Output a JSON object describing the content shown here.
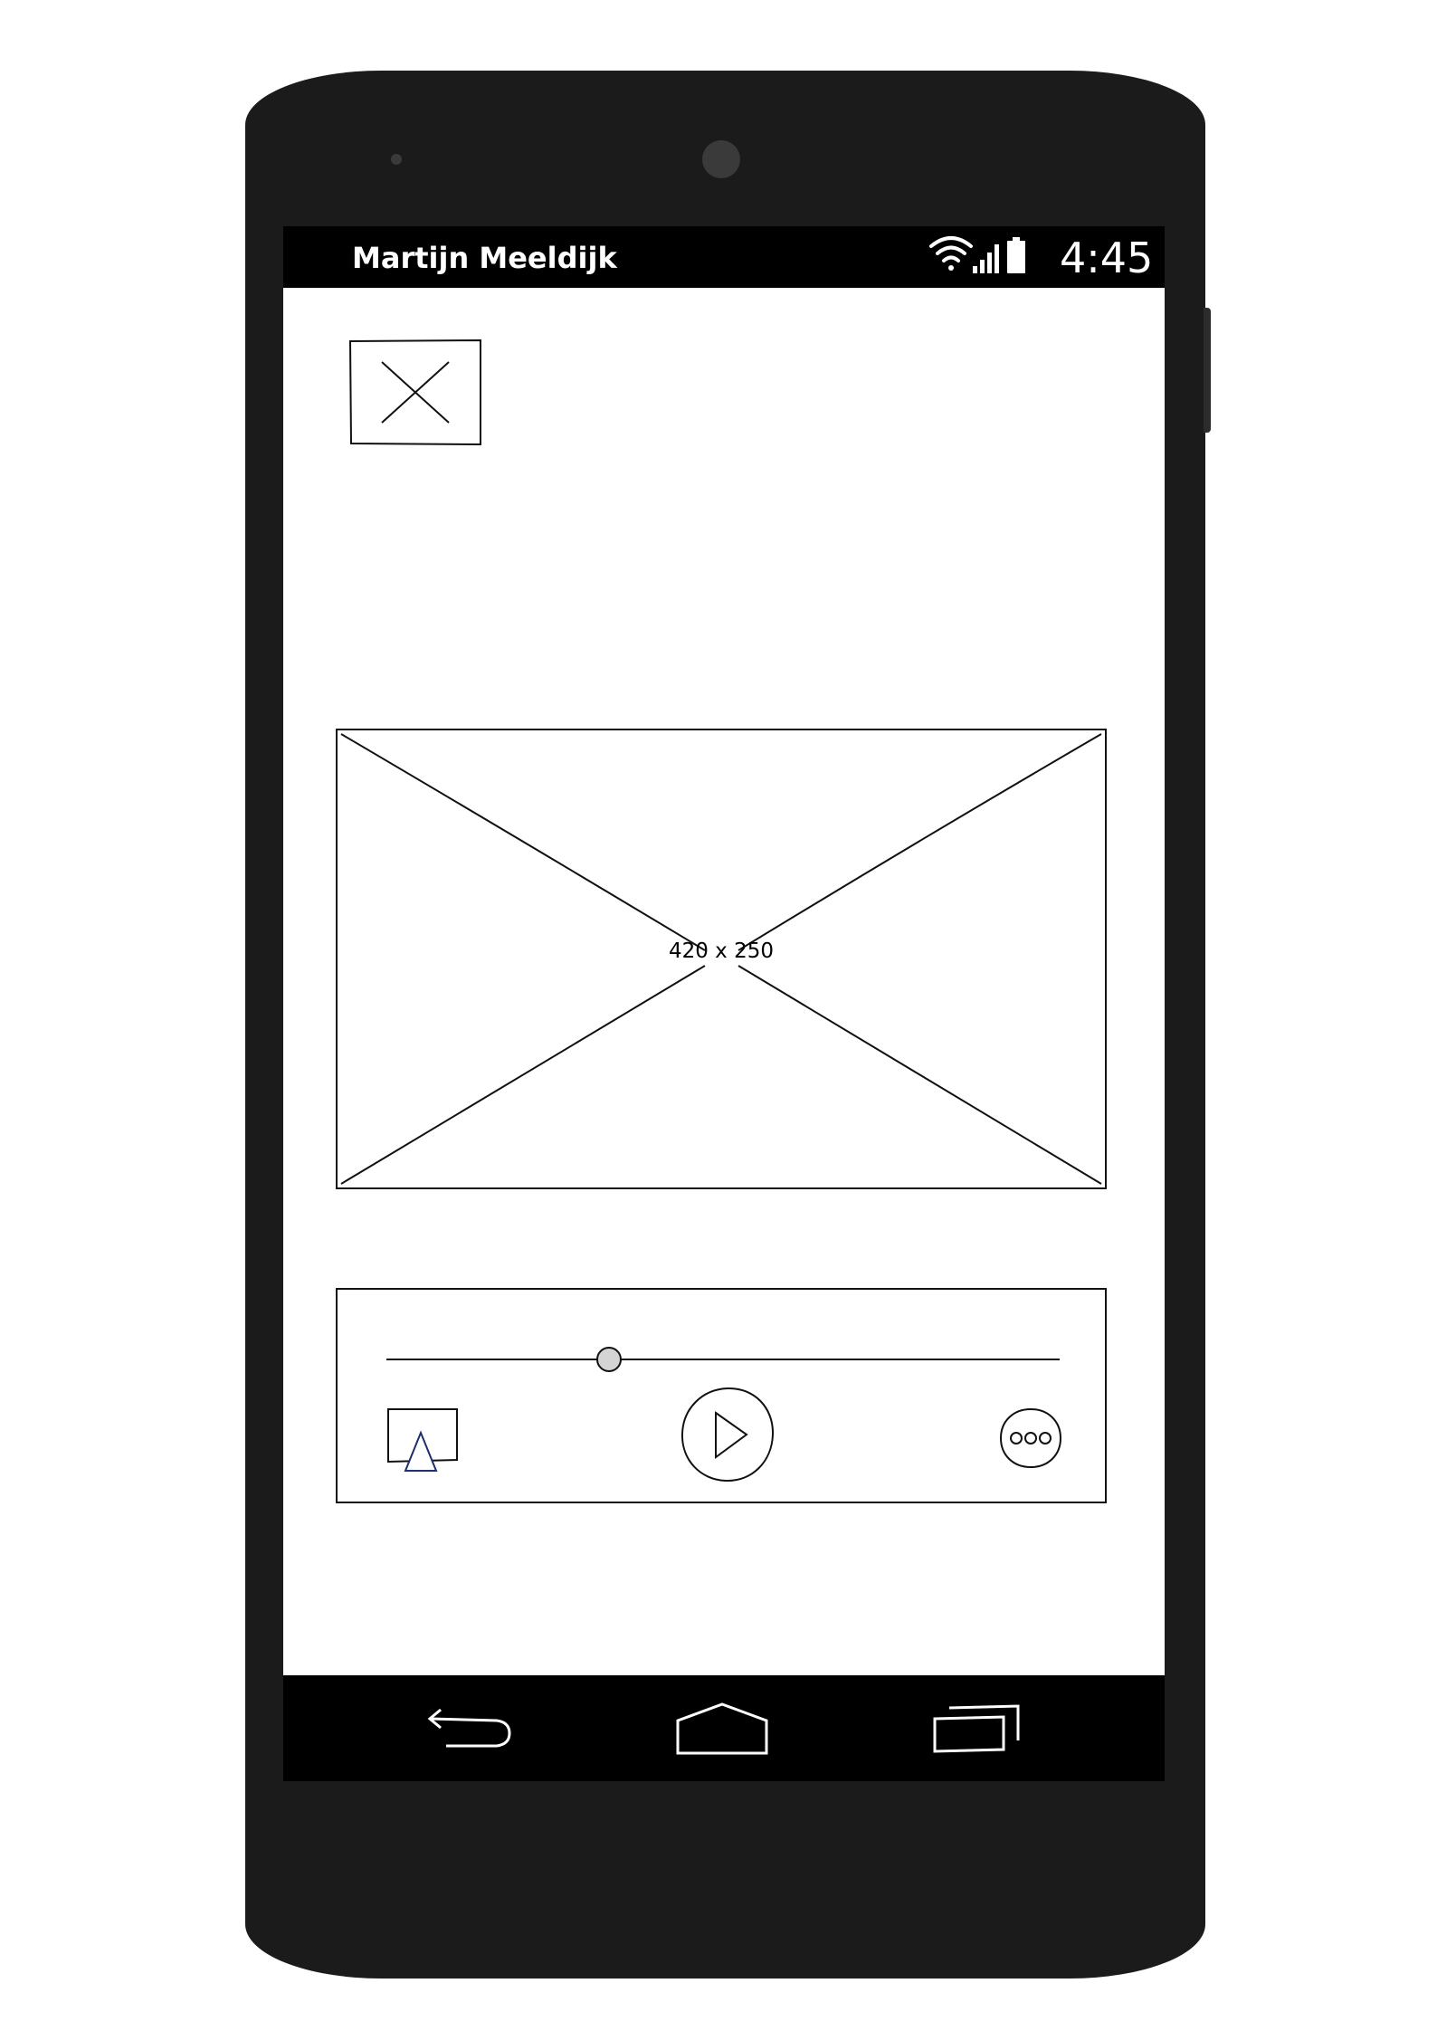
{
  "status_bar": {
    "user_name": "Martijn Meeldijk",
    "time": "4:45",
    "icons": [
      "wifi-icon",
      "signal-icon",
      "battery-icon"
    ]
  },
  "main": {
    "close_button": {
      "icon": "close-icon"
    },
    "image_placeholder": {
      "label": "420 x 250"
    }
  },
  "player": {
    "seek_progress": 0.33,
    "buttons": [
      "airplay-icon",
      "play-icon",
      "more-icon"
    ]
  },
  "nav_bar": {
    "buttons": [
      "back-icon",
      "home-icon",
      "recent-apps-icon"
    ]
  },
  "colors": {
    "phone_body": "#1b1b1b",
    "bar": "#000000",
    "screen": "#ffffff",
    "thumb": "#d4d4d4",
    "airplay_accent": "#1c2f6e"
  }
}
